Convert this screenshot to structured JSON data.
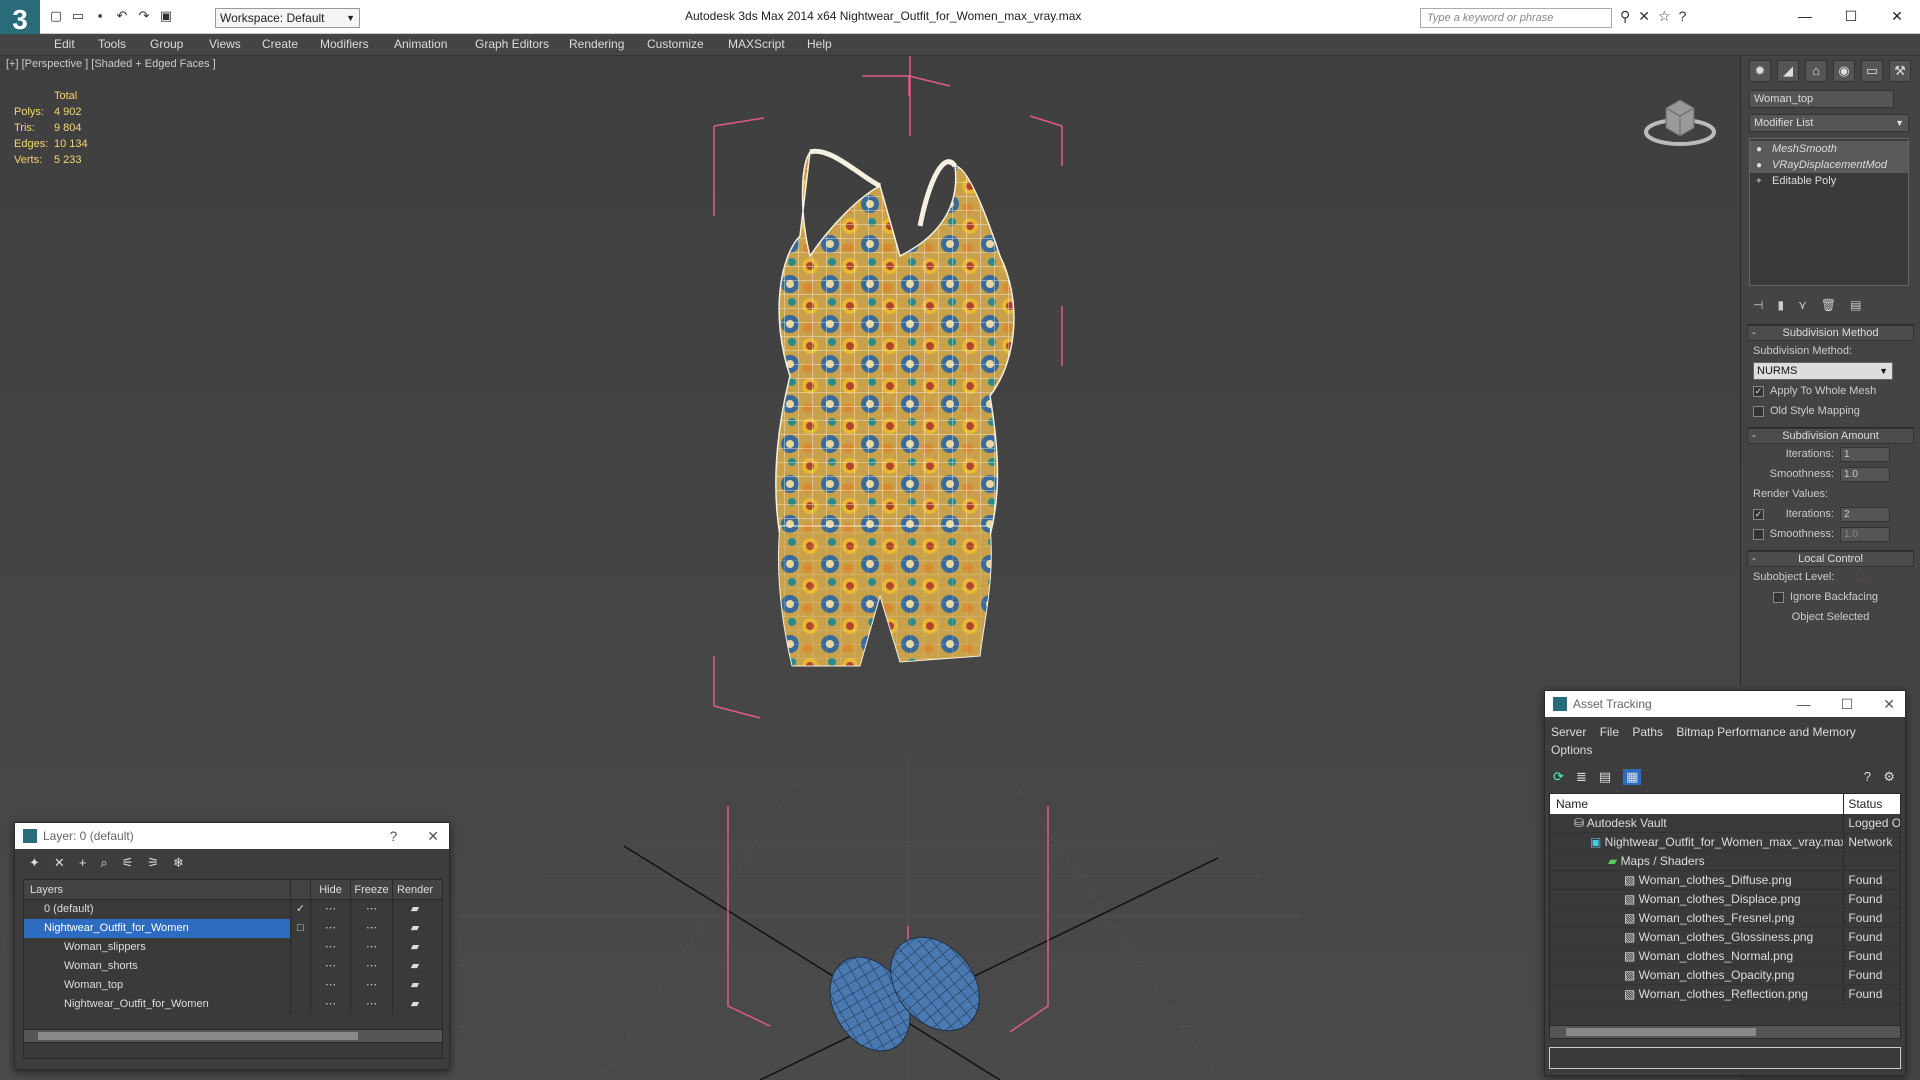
{
  "app": {
    "title": "Autodesk 3ds Max  2014 x64     Nightwear_Outfit_for_Women_max_vray.max",
    "workspace": "Workspace: Default",
    "search_placeholder": "Type a keyword or phrase"
  },
  "menu": [
    "Edit",
    "Tools",
    "Group",
    "Views",
    "Create",
    "Modifiers",
    "Animation",
    "Graph Editors",
    "Rendering",
    "Customize",
    "MAXScript",
    "Help"
  ],
  "viewport": {
    "label": "[+] [Perspective ] [Shaded + Edged Faces ]",
    "stats": {
      "header": "Total",
      "rows": [
        {
          "k": "Polys:",
          "v": "4 902"
        },
        {
          "k": "Tris:",
          "v": "9 804"
        },
        {
          "k": "Edges:",
          "v": "10 134"
        },
        {
          "k": "Verts:",
          "v": "5 233"
        }
      ]
    }
  },
  "command_panel": {
    "object_name": "Woman_top",
    "modifier_list": "Modifier List",
    "stack": [
      {
        "label": "MeshSmooth",
        "selected": true
      },
      {
        "label": "VRayDisplacementMod",
        "selected": true
      },
      {
        "label": "Editable Poly",
        "selected": false
      }
    ],
    "subdivision_method": {
      "title": "Subdivision Method",
      "label": "Subdivision Method:",
      "value": "NURMS",
      "apply_whole": "Apply To Whole Mesh",
      "old_style": "Old Style Mapping"
    },
    "subdivision_amount": {
      "title": "Subdivision Amount",
      "iterations_label": "Iterations:",
      "iterations": "1",
      "smoothness_label": "Smoothness:",
      "smoothness": "1.0",
      "render_values": "Render Values:",
      "r_iterations": "2",
      "r_smoothness": "1.0"
    },
    "local_control": {
      "title": "Local Control",
      "subobject": "Subobject Level:",
      "ignore_backfacing": "Ignore Backfacing",
      "object_selected": "Object Selected"
    }
  },
  "layer_window": {
    "title": "Layer: 0 (default)",
    "help": "?",
    "columns": [
      "Layers",
      "Hide",
      "Freeze",
      "Render"
    ],
    "rows": [
      {
        "name": "0 (default)",
        "indent": 1,
        "selected": false
      },
      {
        "name": "Nightwear_Outfit_for_Women",
        "indent": 1,
        "selected": true
      },
      {
        "name": "Woman_slippers",
        "indent": 2,
        "selected": false
      },
      {
        "name": "Woman_shorts",
        "indent": 2,
        "selected": false
      },
      {
        "name": "Woman_top",
        "indent": 2,
        "selected": false
      },
      {
        "name": "Nightwear_Outfit_for_Women",
        "indent": 2,
        "selected": false
      }
    ]
  },
  "asset_window": {
    "title": "Asset Tracking",
    "menu": [
      "Server",
      "File",
      "Paths",
      "Bitmap Performance and Memory",
      "Options"
    ],
    "columns": [
      "Name",
      "Status"
    ],
    "rows": [
      {
        "name": "Autodesk Vault",
        "status": "Logged O",
        "indent": 1
      },
      {
        "name": "Nightwear_Outfit_for_Women_max_vray.max",
        "status": "Network",
        "indent": 2
      },
      {
        "name": "Maps / Shaders",
        "status": "",
        "indent": 3
      },
      {
        "name": "Woman_clothes_Diffuse.png",
        "status": "Found",
        "indent": 4
      },
      {
        "name": "Woman_clothes_Displace.png",
        "status": "Found",
        "indent": 4
      },
      {
        "name": "Woman_clothes_Fresnel.png",
        "status": "Found",
        "indent": 4
      },
      {
        "name": "Woman_clothes_Glossiness.png",
        "status": "Found",
        "indent": 4
      },
      {
        "name": "Woman_clothes_Normal.png",
        "status": "Found",
        "indent": 4
      },
      {
        "name": "Woman_clothes_Opacity.png",
        "status": "Found",
        "indent": 4
      },
      {
        "name": "Woman_clothes_Reflection.png",
        "status": "Found",
        "indent": 4
      }
    ]
  },
  "colors": {
    "accent_blue": "#2d6cc0",
    "stats_yellow": "#f5d76e",
    "bbox_pink": "#e05a8a",
    "shoe_blue": "#4a78b0"
  }
}
